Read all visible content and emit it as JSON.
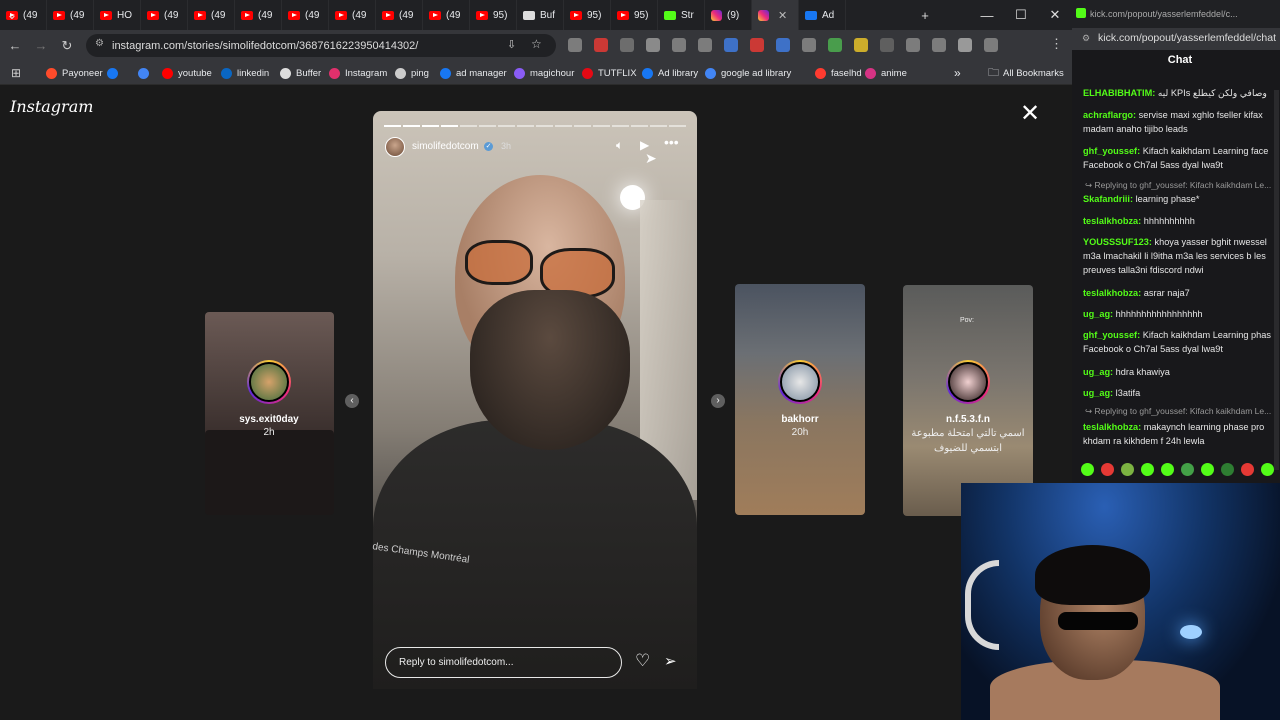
{
  "browser": {
    "tabs": [
      {
        "label": "(49",
        "type": "youtube"
      },
      {
        "label": "(49",
        "type": "youtube"
      },
      {
        "label": "HO",
        "type": "youtube"
      },
      {
        "label": "(49",
        "type": "youtube"
      },
      {
        "label": "(49",
        "type": "youtube"
      },
      {
        "label": "(49",
        "type": "youtube"
      },
      {
        "label": "(49",
        "type": "youtube"
      },
      {
        "label": "(49",
        "type": "youtube"
      },
      {
        "label": "(49",
        "type": "youtube"
      },
      {
        "label": "(49",
        "type": "youtube"
      },
      {
        "label": "95)",
        "type": "youtube"
      },
      {
        "label": "Buf",
        "type": "buffer"
      },
      {
        "label": "95)",
        "type": "youtube"
      },
      {
        "label": "95)",
        "type": "youtube"
      },
      {
        "label": "Str",
        "type": "kick"
      },
      {
        "label": "(9)",
        "type": "instagram"
      },
      {
        "label": "",
        "type": "instagram-active"
      },
      {
        "label": "Ad",
        "type": "meta"
      }
    ],
    "url": "instagram.com/stories/simolifedotcom/3687616223950414302/",
    "bookmarks": [
      {
        "label": "Payoneer",
        "color": "#ff4b2b"
      },
      {
        "label": "",
        "color": "#1877f2"
      },
      {
        "label": "",
        "color": "#4285f4"
      },
      {
        "label": "youtube",
        "color": "#ff0000"
      },
      {
        "label": "linkedin",
        "color": "#0a66c2"
      },
      {
        "label": "Buffer",
        "color": "#dddddd"
      },
      {
        "label": "Instagram",
        "color": "#e1306c"
      },
      {
        "label": "ping",
        "color": "#cccccc"
      },
      {
        "label": "ad manager",
        "color": "#1877f2"
      },
      {
        "label": "magichour",
        "color": "#8a5cf6"
      },
      {
        "label": "TUTFLIX",
        "color": "#e50914"
      },
      {
        "label": "Ad library",
        "color": "#1877f2"
      },
      {
        "label": "google ad library",
        "color": "#4285f4"
      },
      {
        "label": "faselhd",
        "color": "#ff3b30"
      },
      {
        "label": "anime",
        "color": "#d63384"
      }
    ],
    "all_bookmarks": "All Bookmarks",
    "more_bookmarks": "»"
  },
  "instagram": {
    "logo": "Instagram",
    "story": {
      "username": "simolifedotcom",
      "time": "3h",
      "progress_segments_total": 16,
      "progress_segments_done": 4,
      "reply_placeholder": "Reply to simolifedotcom...",
      "shirt_print": "des Champs Montréal"
    },
    "side_stories": [
      {
        "username": "sys.exit0day",
        "time": "2h"
      },
      {
        "username": "bakhorr",
        "time": "20h"
      },
      {
        "username": "n.f.5.3.f.n",
        "caption": "اسمي تالتي امتحلة مطبوعة",
        "caption2": "ابتسمي للضيوف",
        "overlay": "Pov:"
      }
    ]
  },
  "kick": {
    "popup_title": "kick.com/popout/yasserlemfeddel/c...",
    "url": "kick.com/popout/yasserlemfeddel/chat",
    "chat_header": "Chat",
    "messages": [
      {
        "user": "ELHABIBHATIM:",
        "text": " ليه KPIs وصافي ولكن كيطلع"
      },
      {
        "user": "achraflargo:",
        "text": " servise maxi xghlo fseller kifax madam anaho tijibo leads"
      },
      {
        "user": "ghf_youssef:",
        "text": " Kifach kaikhdam Learning face Facebook o Ch7al 5ass dyal lwa9t"
      },
      {
        "reply": "↪ Replying to ghf_youssef: Kifach kaikhdam Le..."
      },
      {
        "user": "Skafandriii:",
        "text": " learning phase*"
      },
      {
        "user": "teslalkhobza:",
        "text": " hhhhhhhhhh"
      },
      {
        "user": "YOUSSSUF123:",
        "text": " khoya yasser bghit nwessel m3a lmachakil li l9itha m3a les services b les preuves talla3ni fdiscord ndwi"
      },
      {
        "user": "teslalkhobza:",
        "text": " asrar naja7"
      },
      {
        "user": "ug_ag:",
        "text": " hhhhhhhhhhhhhhhhh"
      },
      {
        "user": "ghf_youssef:",
        "text": " Kifach kaikhdam Learning phas Facebook o Ch7al 5ass dyal lwa9t"
      },
      {
        "user": "ug_ag:",
        "text": " hdra khawiya"
      },
      {
        "user": "ug_ag:",
        "text": " l3atifa"
      },
      {
        "reply": "↪ Replying to ghf_youssef: Kifach kaikhdam Le..."
      },
      {
        "user": "teslalkhobza:",
        "text": " makaynch learning phase pro khdam ra kikhdem f 24h lewla"
      }
    ]
  },
  "colors": {
    "browser_bg": "#202124",
    "toolbar_bg": "#35363a",
    "page_bg": "#1a1a1a",
    "kick_green": "#53fc18",
    "kick_bg": "#18181b"
  }
}
